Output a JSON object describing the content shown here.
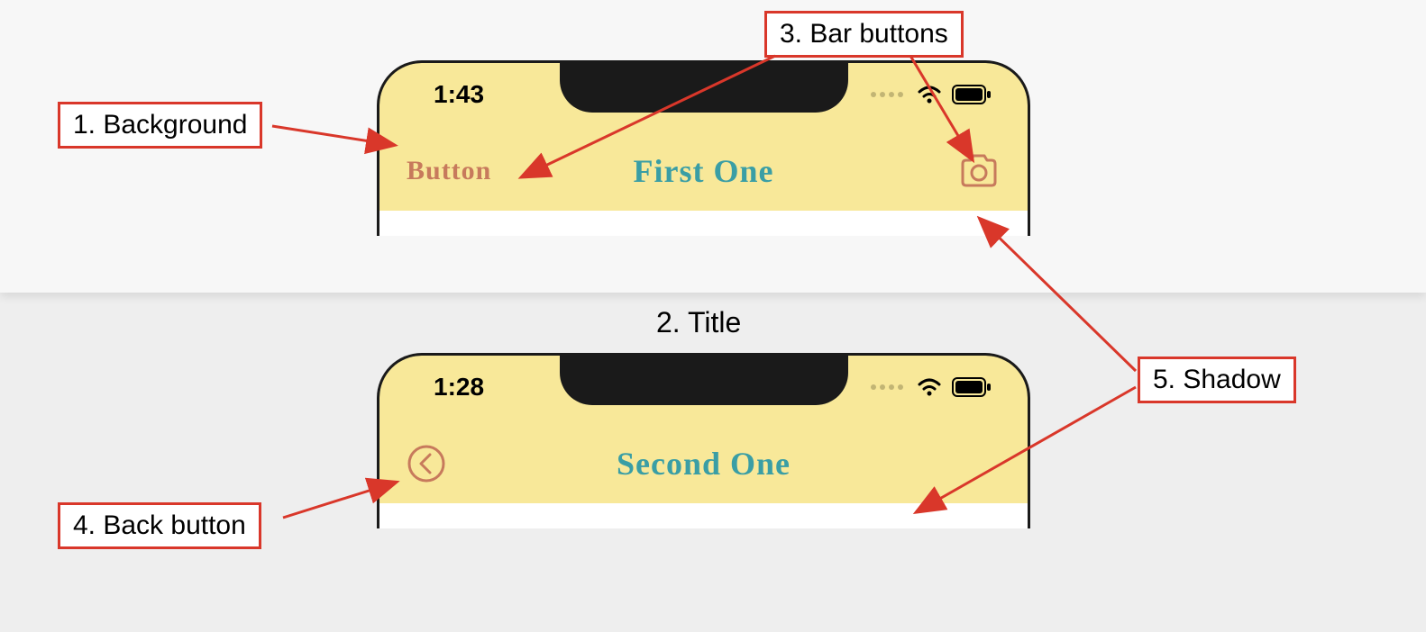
{
  "callouts": {
    "background": "1. Background",
    "title": "2. Title",
    "bar_buttons": "3. Bar buttons",
    "back_button": "4. Back button",
    "shadow": "5. Shadow"
  },
  "phone1": {
    "time": "1:43",
    "nav_title": "First One",
    "left_button": "Button"
  },
  "phone2": {
    "time": "1:28",
    "nav_title": "Second One"
  },
  "colors": {
    "navbar_bg": "#f8e899",
    "title_color": "#3a9ea5",
    "button_color": "#c77a5c",
    "callout_border": "#d9372a"
  }
}
